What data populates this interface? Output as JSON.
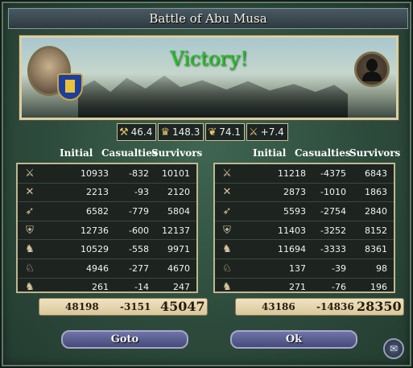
{
  "title": "Battle of Abu Musa",
  "result": "Victory!",
  "modifiers": [
    {
      "icon": "crossed-axes-icon",
      "glyph": "⚒",
      "value": "46.4"
    },
    {
      "icon": "crown-icon",
      "glyph": "♛",
      "value": "148.3"
    },
    {
      "icon": "laurel-icon",
      "glyph": "❦",
      "value": "74.1"
    },
    {
      "icon": "terrain-icon",
      "glyph": "⚔",
      "value": "+7.4"
    }
  ],
  "columns": {
    "initial": "Initial",
    "casualties": "Casualties",
    "survivors": "Survivors"
  },
  "left": {
    "rows": [
      {
        "icon": "shield-spear-icon",
        "glyph": "⚔",
        "initial": "10933",
        "casualties": "-832",
        "survivors": "10101"
      },
      {
        "icon": "crossed-swords-icon",
        "glyph": "✕",
        "initial": "2213",
        "casualties": "-93",
        "survivors": "2120"
      },
      {
        "icon": "bow-icon",
        "glyph": "➶",
        "initial": "6582",
        "casualties": "-779",
        "survivors": "5804"
      },
      {
        "icon": "heavy-shield-icon",
        "glyph": "⛨",
        "initial": "12736",
        "casualties": "-600",
        "survivors": "12137"
      },
      {
        "icon": "cavalry-icon",
        "glyph": "♞",
        "initial": "10529",
        "casualties": "-558",
        "survivors": "9971"
      },
      {
        "icon": "horse-archer-icon",
        "glyph": "♘",
        "initial": "4946",
        "casualties": "-277",
        "survivors": "4670"
      },
      {
        "icon": "knight-icon",
        "glyph": "♞",
        "initial": "261",
        "casualties": "-14",
        "survivors": "247"
      }
    ],
    "totals": {
      "initial": "48198",
      "casualties": "-3151",
      "survivors": "45047"
    }
  },
  "right": {
    "rows": [
      {
        "icon": "shield-spear-icon",
        "glyph": "⚔",
        "initial": "11218",
        "casualties": "-4375",
        "survivors": "6843"
      },
      {
        "icon": "crossed-swords-icon",
        "glyph": "✕",
        "initial": "2873",
        "casualties": "-1010",
        "survivors": "1863"
      },
      {
        "icon": "bow-icon",
        "glyph": "➶",
        "initial": "5593",
        "casualties": "-2754",
        "survivors": "2840"
      },
      {
        "icon": "heavy-shield-icon",
        "glyph": "⛨",
        "initial": "11403",
        "casualties": "-3252",
        "survivors": "8152"
      },
      {
        "icon": "cavalry-icon",
        "glyph": "♞",
        "initial": "11694",
        "casualties": "-3333",
        "survivors": "8361"
      },
      {
        "icon": "horse-archer-icon",
        "glyph": "♘",
        "initial": "137",
        "casualties": "-39",
        "survivors": "98"
      },
      {
        "icon": "knight-icon",
        "glyph": "♞",
        "initial": "271",
        "casualties": "-76",
        "survivors": "196"
      }
    ],
    "totals": {
      "initial": "43186",
      "casualties": "-14836",
      "survivors": "28350"
    }
  },
  "buttons": {
    "goto": "Goto",
    "ok": "Ok"
  },
  "mail_glyph": "✉",
  "colors": {
    "victory": "#22c322",
    "button": "#5a5f92",
    "frame": "#2f4a3c"
  }
}
